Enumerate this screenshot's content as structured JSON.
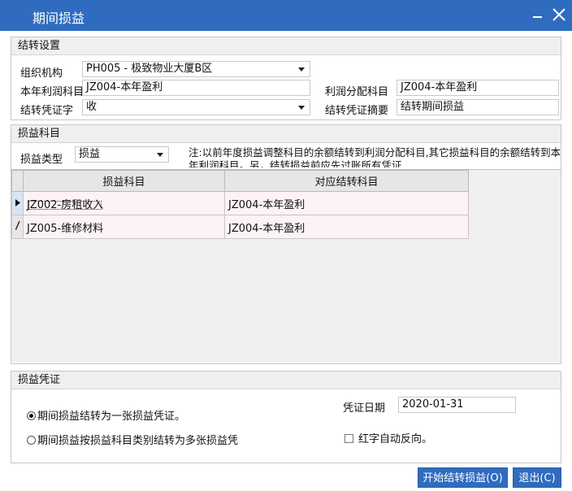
{
  "window": {
    "title": "期间损益",
    "minimize_icon": "minimize-icon",
    "close_icon": "close-icon",
    "titlebar_color": "#2f6cbf"
  },
  "transfer_settings": {
    "header": "结转设置",
    "org_label": "组织机构",
    "org_value": "PH005 - 极致物业大厦B区",
    "profit_label": "本年利润科目",
    "profit_value": "JZ004-本年盈利",
    "distribution_label": "利润分配科目",
    "distribution_value": "JZ004-本年盈利",
    "voucher_type_label": "结转凭证字",
    "voucher_type_value": "收",
    "summary_label": "结转凭证摘要",
    "summary_value": "结转期间损益"
  },
  "pl_accounts": {
    "header": "损益科目",
    "type_label": "损益类型",
    "type_value": "损益",
    "note": "注:以前年度损益调整科目的余额结转到利润分配科目,其它损益科目的余额结转到本年利润科目。另，结转损益前应先过账所有凭证",
    "columns": [
      "损益科目",
      "对应结转科目"
    ],
    "rows": [
      {
        "account": "JZ002-房租收入",
        "target": "JZ004-本年盈利"
      },
      {
        "account": "JZ005-维修材料",
        "target": "JZ004-本年盈利"
      }
    ]
  },
  "pl_voucher": {
    "header": "损益凭证",
    "option_single": "期间损益结转为一张损益凭证。",
    "option_multi": "期间损益按损益科目类别结转为多张损益凭",
    "date_label": "凭证日期",
    "date_value": "2020-01-31",
    "red_reverse_label": "红字自动反向。",
    "selected_option": "single"
  },
  "buttons": {
    "start": "开始结转损益(O)",
    "exit": "退出(C)"
  }
}
